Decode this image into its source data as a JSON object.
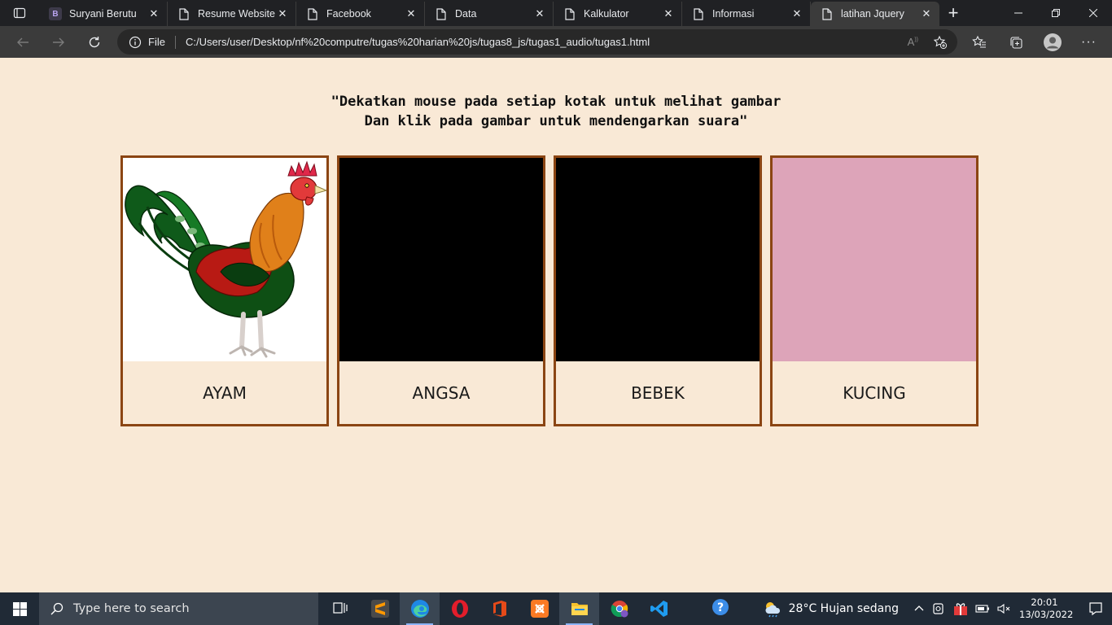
{
  "browser": {
    "tabs": [
      {
        "title": "Suryani Berutu",
        "favicon": "letter-b",
        "favicon_text": "B",
        "active": false
      },
      {
        "title": "Resume Website",
        "favicon": "page-icon",
        "active": false
      },
      {
        "title": "Facebook",
        "favicon": "page-icon",
        "active": false
      },
      {
        "title": "Data",
        "favicon": "page-icon",
        "active": false
      },
      {
        "title": "Kalkulator",
        "favicon": "page-icon",
        "active": false
      },
      {
        "title": "Informasi",
        "favicon": "page-icon",
        "active": false
      },
      {
        "title": "latihan Jquery",
        "favicon": "page-icon",
        "active": true
      }
    ],
    "address": {
      "scheme_label": "File",
      "url": "C:/Users/user/Desktop/nf%20computre/tugas%20harian%20js/tugas8_js/tugas1_audio/tugas1.html"
    }
  },
  "page": {
    "instruction_line1": "\"Dekatkan mouse pada setiap kotak untuk melihat gambar",
    "instruction_line2": "Dan klik pada gambar untuk mendengarkan suara\"",
    "cards": [
      {
        "label": "AYAM",
        "image": "rooster",
        "color": "#ffffff"
      },
      {
        "label": "ANGSA",
        "image": "hidden",
        "color": "#000000"
      },
      {
        "label": "BEBEK",
        "image": "hidden",
        "color": "#000000"
      },
      {
        "label": "KUCING",
        "image": "hidden",
        "color": "#dda4b9"
      }
    ],
    "colors": {
      "background": "#f9e9d6",
      "card_border": "#8b4513"
    }
  },
  "taskbar": {
    "search_placeholder": "Type here to search",
    "weather": "28°C  Hujan sedang",
    "time": "20:01",
    "date": "13/03/2022"
  }
}
